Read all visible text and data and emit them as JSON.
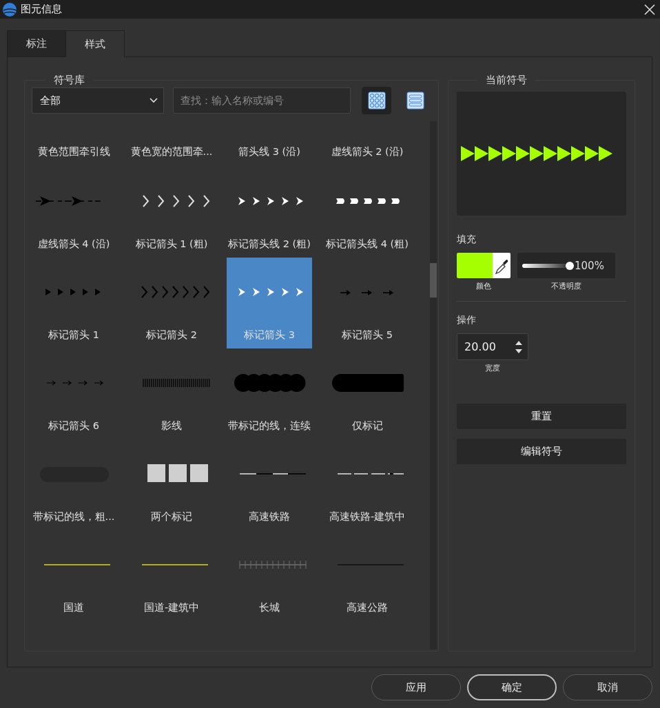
{
  "window": {
    "title": "图元信息"
  },
  "tabs": [
    {
      "label": "标注",
      "selected": false
    },
    {
      "label": "样式",
      "selected": true
    }
  ],
  "symbol_library": {
    "title": "符号库",
    "category": "全部",
    "search": {
      "placeholder": "查找：输入名称或编号"
    },
    "view_modes": [
      {
        "kind": "grid",
        "selected": true
      },
      {
        "kind": "list",
        "selected": false
      }
    ],
    "symbols": [
      {
        "label": "黄色范围牵引线",
        "kind": "clipped",
        "selected": false
      },
      {
        "label": "黄色宽的范围牵...",
        "kind": "clipped",
        "selected": false
      },
      {
        "label": "箭头线 3 (沿)",
        "kind": "clipped",
        "selected": false
      },
      {
        "label": "虚线箭头 2 (沿)",
        "kind": "clipped",
        "selected": false
      },
      {
        "label": "虚线箭头 4 (沿)",
        "kind": "arrow-dash",
        "selected": false
      },
      {
        "label": "标记箭头 1 (粗)",
        "kind": "chevrons-light",
        "selected": false
      },
      {
        "label": "标记箭头线 2 (粗)",
        "kind": "triangles-white",
        "selected": false
      },
      {
        "label": "标记箭头线 4 (粗)",
        "kind": "bullets-white",
        "selected": false
      },
      {
        "label": "标记箭头  1",
        "kind": "triangles-black",
        "selected": false
      },
      {
        "label": "标记箭头  2",
        "kind": "chevrons-black",
        "selected": false
      },
      {
        "label": "标记箭头  3",
        "kind": "triangles-white",
        "selected": true
      },
      {
        "label": "标记箭头  5",
        "kind": "arrows-spaced",
        "selected": false
      },
      {
        "label": "标记箭头  6",
        "kind": "arrows-thin",
        "selected": false
      },
      {
        "label": "影线",
        "kind": "hatch",
        "selected": false
      },
      {
        "label": "带标记的线，连续",
        "kind": "circles",
        "selected": false
      },
      {
        "label": "仅标记",
        "kind": "bar",
        "selected": false
      },
      {
        "label": "带标记的线，粗...",
        "kind": "faint",
        "selected": false
      },
      {
        "label": "两个标记",
        "kind": "squares",
        "selected": false
      },
      {
        "label": "高速铁路",
        "kind": "rail",
        "selected": false
      },
      {
        "label": "高速铁路-建筑中",
        "kind": "rail-dashed",
        "selected": false
      },
      {
        "label": "国道",
        "kind": "line-yellow",
        "selected": false
      },
      {
        "label": "国道-建筑中",
        "kind": "line-yellow",
        "selected": false
      },
      {
        "label": "长城",
        "kind": "ticks",
        "selected": false
      },
      {
        "label": "高速公路",
        "kind": "line-dark",
        "selected": false
      }
    ]
  },
  "current_symbol": {
    "title": "当前符号",
    "fill": {
      "label": "填充",
      "color": "#a6ff00",
      "color_caption": "颜色",
      "opacity": {
        "level": 1,
        "reading": "100%",
        "caption": "不透明度"
      }
    },
    "operation": {
      "label": "操作",
      "width": {
        "value": "20.00",
        "caption": "宽度"
      }
    },
    "buttons": [
      "重置",
      "编辑符号"
    ]
  },
  "footer_buttons": [
    {
      "label": "应用",
      "default": false
    },
    {
      "label": "确定",
      "default": true
    },
    {
      "label": "取消",
      "default": false
    }
  ]
}
